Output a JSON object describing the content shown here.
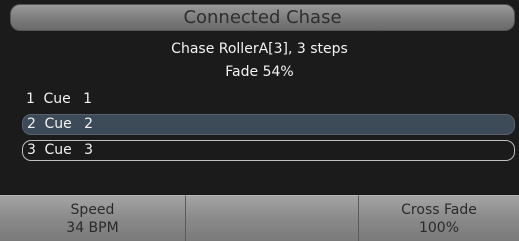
{
  "header": {
    "title": "Connected Chase"
  },
  "info": {
    "line1": "Chase RollerA[3], 3 steps",
    "line2": "Fade 54%"
  },
  "cues": [
    {
      "number": "1",
      "label": "Cue",
      "value": "1"
    },
    {
      "number": "2",
      "label": "Cue",
      "value": "2"
    },
    {
      "number": "3",
      "label": "Cue",
      "value": "3"
    }
  ],
  "footer": {
    "speed_label": "Speed",
    "speed_value": "34 BPM",
    "middle_label": "",
    "crossfade_label": "Cross Fade",
    "crossfade_value": "100%"
  }
}
